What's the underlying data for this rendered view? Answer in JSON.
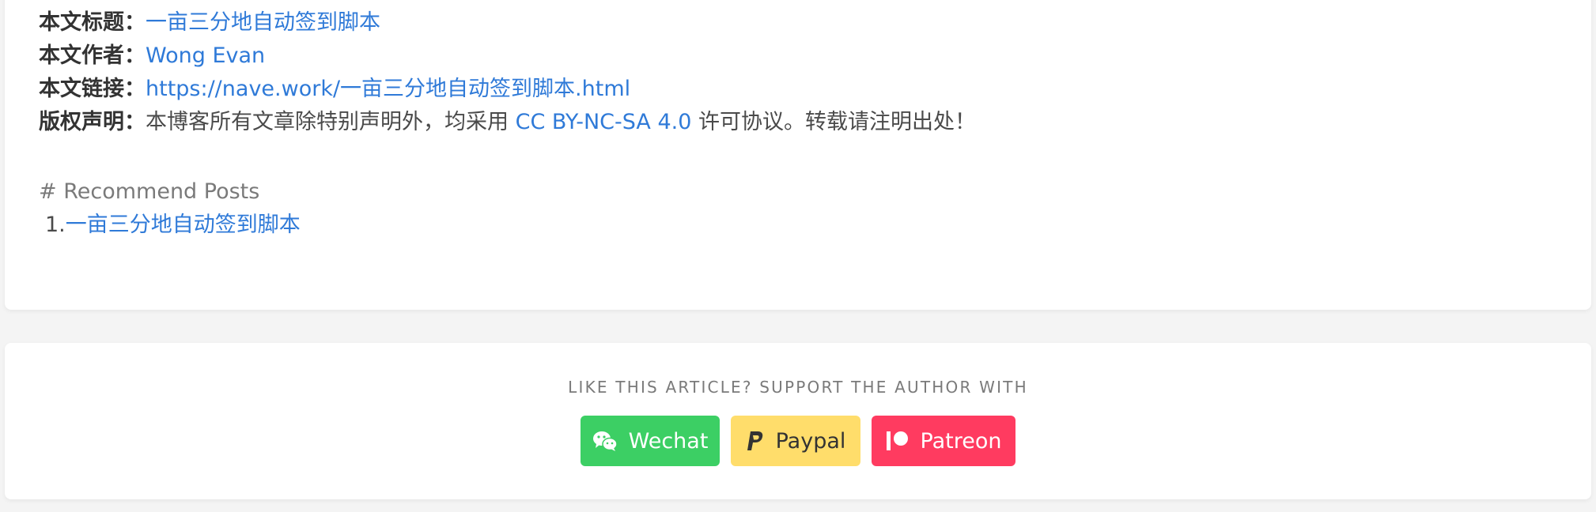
{
  "copyright": {
    "title_label": "本文标题：",
    "title_value": "一亩三分地自动签到脚本",
    "author_label": "本文作者：",
    "author_value": "Wong Evan",
    "link_label": "本文链接：",
    "link_value": "https://nave.work/一亩三分地自动签到脚本.html",
    "license_label": "版权声明：",
    "license_text_before": "本博客所有文章除特别声明外，均采用 ",
    "license_link": "CC BY-NC-SA 4.0",
    "license_text_after": " 许可协议。转载请注明出处！"
  },
  "recommend": {
    "heading": "# Recommend Posts",
    "items": [
      {
        "number": "1.",
        "title": "一亩三分地自动签到脚本"
      }
    ]
  },
  "support": {
    "heading": "LIKE THIS ARTICLE? SUPPORT THE AUTHOR WITH",
    "buttons": [
      {
        "label": "Wechat",
        "icon": "wechat-icon",
        "color": "#3ccf64"
      },
      {
        "label": "Paypal",
        "icon": "paypal-icon",
        "color": "#ffdd6b"
      },
      {
        "label": "Patreon",
        "icon": "patreon-icon",
        "color": "#ff3b60"
      }
    ]
  },
  "colors": {
    "link": "#2f7ad8",
    "background": "#f4f4f4",
    "card": "#ffffff"
  }
}
